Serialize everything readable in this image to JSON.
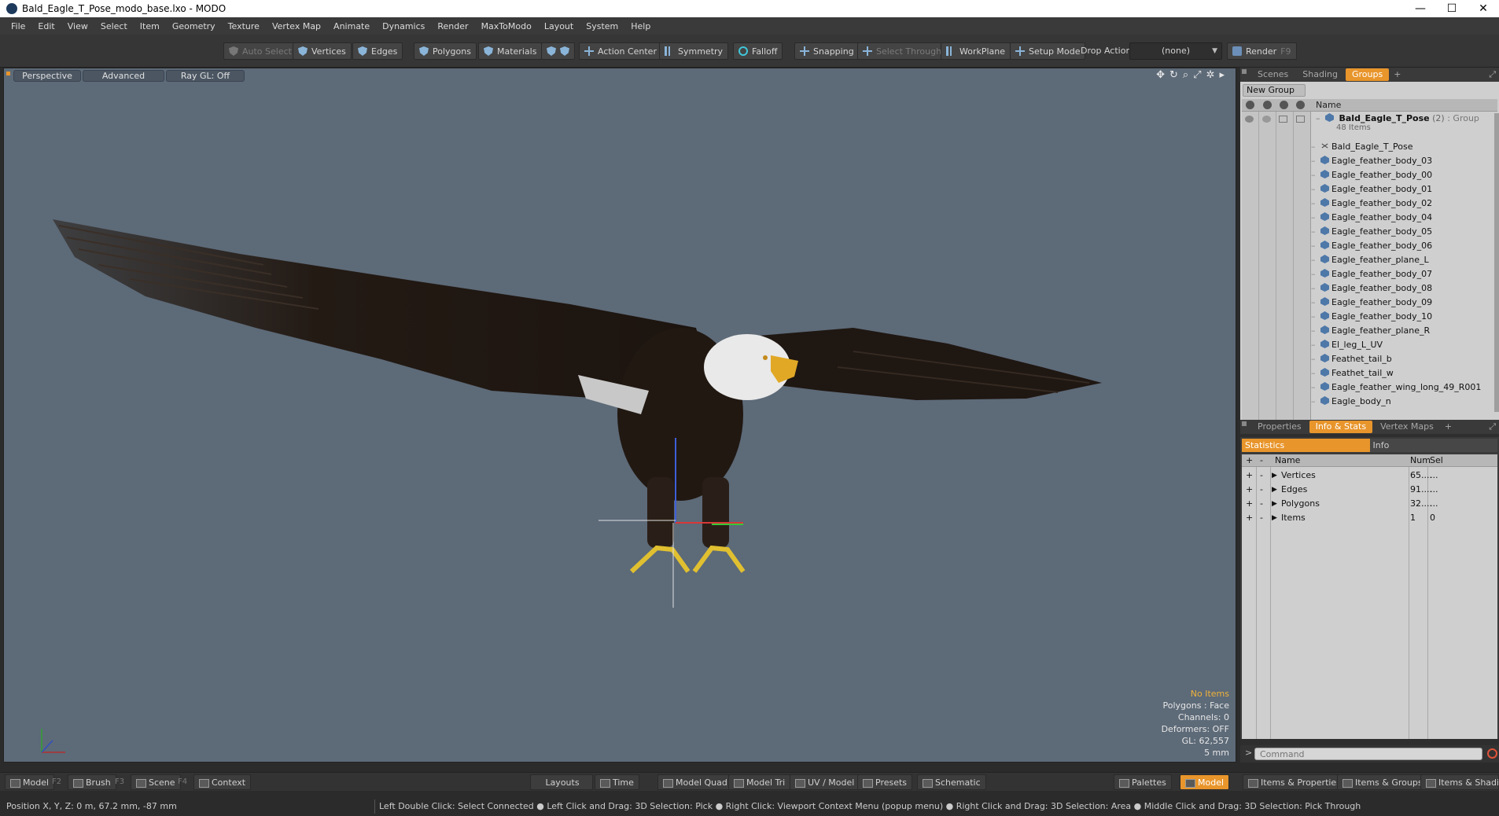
{
  "window": {
    "title": "Bald_Eagle_T_Pose_modo_base.lxo - MODO",
    "minimize": "—",
    "maximize": "☐",
    "close": "✕"
  },
  "menu": [
    "File",
    "Edit",
    "View",
    "Select",
    "Item",
    "Geometry",
    "Texture",
    "Vertex Map",
    "Animate",
    "Dynamics",
    "Render",
    "MaxToModo",
    "Layout",
    "System",
    "Help"
  ],
  "toolbar": {
    "auto_select": "Auto Select",
    "vertices": "Vertices",
    "edges": "Edges",
    "polygons": "Polygons",
    "materials": "Materials",
    "action_center": "Action Center",
    "symmetry": "Symmetry",
    "falloff": "Falloff",
    "snapping": "Snapping",
    "select_through": "Select Through",
    "workplane": "WorkPlane",
    "setup_mode": "Setup Mode",
    "drop_action_label": "Drop Action",
    "drop_action_value": "(none)",
    "render": "Render",
    "render_key": "F9"
  },
  "viewport": {
    "tabs": [
      "Perspective",
      "Advanced",
      "Ray GL: Off"
    ],
    "info": {
      "no_items": "No Items",
      "polygons": "Polygons : Face",
      "channels": "Channels: 0",
      "deformers": "Deformers: OFF",
      "gl": "GL: 62,557",
      "scale": "5 mm"
    }
  },
  "groups_panel": {
    "tabs": [
      "Scenes",
      "Shading",
      "Groups"
    ],
    "active_tab": "Groups",
    "new_group": "New Group",
    "name_header": "Name",
    "root": {
      "name": "Bald_Eagle_T_Pose",
      "count": "(2)",
      "type": ": Group",
      "sub": "48 Items"
    },
    "items": [
      "Bald_Eagle_T_Pose",
      "Eagle_feather_body_03",
      "Eagle_feather_body_00",
      "Eagle_feather_body_01",
      "Eagle_feather_body_02",
      "Eagle_feather_body_04",
      "Eagle_feather_body_05",
      "Eagle_feather_body_06",
      "Eagle_feather_plane_L",
      "Eagle_feather_body_07",
      "Eagle_feather_body_08",
      "Eagle_feather_body_09",
      "Eagle_feather_body_10",
      "Eagle_feather_plane_R",
      "El_leg_L_UV",
      "Feathet_tail_b",
      "Feathet_tail_w",
      "Eagle_feather_wing_long_49_R001",
      "Eagle_body_n"
    ]
  },
  "stats_panel": {
    "tabs": [
      "Properties",
      "Info & Stats",
      "Vertex Maps"
    ],
    "active_tab": "Info & Stats",
    "subtabs": [
      "Statistics",
      "Info"
    ],
    "headers": {
      "name": "Name",
      "num": "Num",
      "sel": "Sel"
    },
    "rows": [
      {
        "name": "Vertices",
        "num": "65....",
        "sel": "..."
      },
      {
        "name": "Edges",
        "num": "91....",
        "sel": "..."
      },
      {
        "name": "Polygons",
        "num": "32....",
        "sel": "..."
      },
      {
        "name": "Items",
        "num": "1",
        "sel": "0"
      }
    ]
  },
  "command": {
    "placeholder": "Command",
    "prompt": ">"
  },
  "bottom_tabs": {
    "model": "Model",
    "model_key": "F2",
    "brush": "Brush",
    "brush_key": "F3",
    "scene": "Scene",
    "scene_key": "F4",
    "context": "Context",
    "layouts": "Layouts",
    "time": "Time",
    "model_quad": "Model Quad",
    "model_tri": "Model Tri",
    "uv_model": "UV / Model",
    "presets": "Presets",
    "schematic": "Schematic",
    "palettes": "Palettes",
    "model_active": "Model",
    "items_properties": "Items & Properties",
    "items_groups": "Items & Groups",
    "items_shading": "Items & Shading"
  },
  "status": {
    "position": "Position X, Y, Z:   0 m, 67.2 mm, -87 mm",
    "hints": "Left Double Click: Select Connected ● Left Click and Drag: 3D Selection: Pick ● Right Click: Viewport Context Menu (popup menu) ● Right Click and Drag: 3D Selection: Area ● Middle Click and Drag: 3D Selection: Pick Through"
  },
  "colors": {
    "accent": "#e8952b",
    "viewport_bg": "#5d6a78"
  }
}
